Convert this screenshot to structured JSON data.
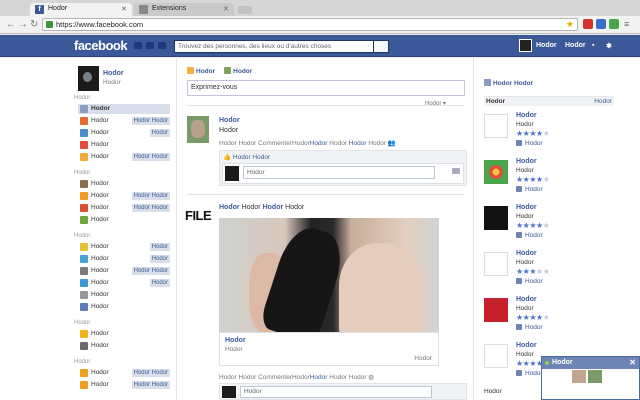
{
  "browser": {
    "tabs": [
      {
        "label": "Hodor",
        "favicon": "facebook-favicon",
        "active": true
      },
      {
        "label": "Extensions",
        "favicon": "puzzle-favicon",
        "active": false
      }
    ],
    "url": "https://www.facebook.com"
  },
  "fbbar": {
    "logo": "facebook",
    "search_placeholder": "Trouvez des personnes, des lieux ou d'autres choses",
    "user_name": "Hodor",
    "home_label": "Hodor"
  },
  "leftnav": {
    "profile": {
      "name": "Hodor",
      "sub": "Hodor"
    },
    "sections": [
      {
        "title": "Hodor",
        "items": [
          {
            "label": "Hodor",
            "badge": "",
            "active": true,
            "color": "#8b9dc3"
          },
          {
            "label": "Hodor",
            "badge": "Hodor Hodor",
            "active": false,
            "color": "#e36b2e"
          },
          {
            "label": "Hodor",
            "badge": "Hodor",
            "active": false,
            "color": "#4c8ec9"
          },
          {
            "label": "Hodor",
            "badge": "",
            "active": false,
            "color": "#e14b3a"
          },
          {
            "label": "Hodor",
            "badge": "Hodor Hodor",
            "active": false,
            "color": "#f0a93a"
          }
        ]
      },
      {
        "title": "Hodor",
        "items": [
          {
            "label": "Hodor",
            "badge": "",
            "active": false,
            "color": "#8a6d4d"
          },
          {
            "label": "Hodor",
            "badge": "Hodor Hodor",
            "active": false,
            "color": "#f29b2d"
          },
          {
            "label": "Hodor",
            "badge": "Hodor Hodor",
            "active": false,
            "color": "#d9532c"
          },
          {
            "label": "Hodor",
            "badge": "",
            "active": false,
            "color": "#6ca63c"
          }
        ]
      },
      {
        "title": "Hodor",
        "items": [
          {
            "label": "Hodor",
            "badge": "Hodor",
            "active": false,
            "color": "#e9c02f"
          },
          {
            "label": "Hodor",
            "badge": "Hodor",
            "active": false,
            "color": "#49a3d6"
          },
          {
            "label": "Hodor",
            "badge": "Hodor Hodor",
            "active": false,
            "color": "#7b7b7b"
          },
          {
            "label": "Hodor",
            "badge": "Hodor",
            "active": false,
            "color": "#3b9ad9"
          },
          {
            "label": "Hodor",
            "badge": "",
            "active": false,
            "color": "#999999"
          },
          {
            "label": "Hodor",
            "badge": "",
            "active": false,
            "color": "#5d7bb8"
          }
        ]
      },
      {
        "title": "Hodor",
        "items": [
          {
            "label": "Hodor",
            "badge": "",
            "active": false,
            "color": "#f1b21c"
          },
          {
            "label": "Hodor",
            "badge": "",
            "active": false,
            "color": "#6b6b6b"
          }
        ]
      },
      {
        "title": "Hodor",
        "items": [
          {
            "label": "Hodor",
            "badge": "Hodor Hodor",
            "active": false,
            "color": "#f0a020"
          },
          {
            "label": "Hodor",
            "badge": "Hodor Hodor",
            "active": false,
            "color": "#f0a020"
          }
        ]
      }
    ]
  },
  "composer": {
    "tab1": "Hodor",
    "tab2": "Hodor",
    "placeholder": "Exprimez-vous",
    "audience": "Hodor ▾"
  },
  "post1": {
    "name": "Hodor",
    "sub": "Hodor",
    "actions": [
      "Hodor",
      "Hodor",
      "CommenterHodor",
      "Hodor",
      "Hodor",
      "Hodor",
      "Hodor"
    ],
    "likes": "Hodor Hodor",
    "comment_placeholder": "Hodor"
  },
  "post2": {
    "file_label": "FILE",
    "head": [
      "Hodor",
      "Hodor",
      "Hodor",
      "Hodor"
    ],
    "link_title": "Hodor",
    "link_sub": "Hodor",
    "link_source": "Hodor",
    "actions": [
      "Hodor",
      "Hodor",
      "CommenterHodor",
      "Hodor",
      "Hodor",
      "Hodor"
    ],
    "comment_placeholder": "Hodor"
  },
  "rightcol": {
    "tab": "Hodor Hodor",
    "header": "Hodor",
    "header_right": "Hodor",
    "apps": [
      {
        "name": "Hodor",
        "sub": "Hodor",
        "rating": 4,
        "likes": "Hodor",
        "logo": "spectrum-logo"
      },
      {
        "name": "Hodor",
        "sub": "Hodor",
        "rating": 4,
        "likes": "Hodor",
        "logo": "flower-logo"
      },
      {
        "name": "Hodor",
        "sub": "Hodor",
        "rating": 4.5,
        "likes": "Hodor",
        "logo": "tmovie-logo"
      },
      {
        "name": "Hodor",
        "sub": "Hodor",
        "rating": 3.5,
        "likes": "Hodor",
        "logo": "nendstar-logo"
      },
      {
        "name": "Hodor",
        "sub": "Hodor",
        "rating": 4,
        "likes": "Hodor",
        "logo": "cafe-logo"
      },
      {
        "name": "Hodor",
        "sub": "Hodor",
        "rating": 4,
        "likes": "Hodor",
        "logo": "brand-logo"
      }
    ],
    "footer": "Hodor"
  },
  "chat": {
    "name": "Hodor"
  },
  "colors": {
    "fb_blue": "#3b5998",
    "nav_highlight": "#d8dfea"
  }
}
